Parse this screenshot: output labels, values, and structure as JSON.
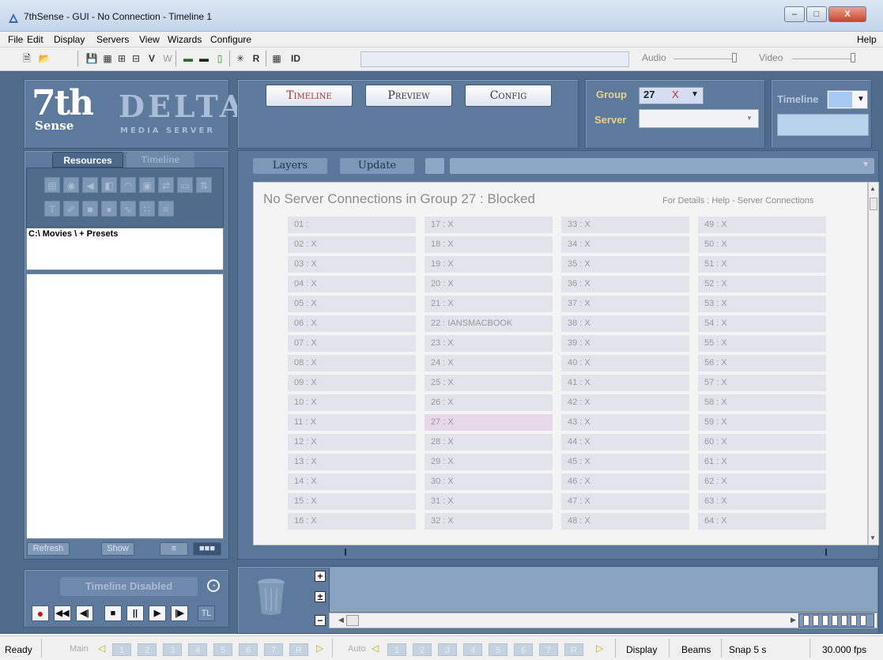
{
  "window": {
    "title": "7thSense -  GUI  - No Connection - Timeline 1",
    "minimize_icon": "minimize-icon",
    "maximize_icon": "maximize-icon",
    "close_label": "X"
  },
  "menu": {
    "file": "File",
    "edit": "Edit",
    "display": "Display",
    "servers": "Servers",
    "view": "View",
    "wizards": "Wizards",
    "configure": "Configure",
    "help": "Help"
  },
  "toolbar": {
    "v_label": "V",
    "w_label": "W",
    "r_label": "R",
    "id_label": "ID",
    "audio_label": "Audio",
    "video_label": "Video"
  },
  "logo": {
    "brand_top": "7th",
    "brand_bottom": "Sense",
    "product": "DELTA",
    "product_sub": "MEDIA SERVER"
  },
  "modes": {
    "timeline": "Timeline",
    "preview": "Preview",
    "config": "Config",
    "active": "timeline"
  },
  "group": {
    "label": "Group",
    "value": "27",
    "clear": "X",
    "server_label": "Server",
    "server_value": "",
    "timeline_label": "Timeline"
  },
  "left": {
    "tabs": [
      "Resources",
      "Timeline"
    ],
    "active_tab": "Resources",
    "path": "C:\\ Movies \\  + Presets",
    "refresh": "Refresh",
    "show": "Show"
  },
  "center": {
    "layers": "Layers",
    "update": "Update",
    "message": "No Server Connections in Group 27 : Blocked",
    "details": "For Details : Help - Server Connections",
    "columns": [
      [
        "01 :",
        "02 : X",
        "03 : X",
        "04 : X",
        "05 : X",
        "06 : X",
        "07 : X",
        "08 : X",
        "09 : X",
        "10 : X",
        "11 : X",
        "12 : X",
        "13 : X",
        "14 : X",
        "15 : X",
        "16 : X"
      ],
      [
        "17 : X",
        "18 : X",
        "19 : X",
        "20 : X",
        "21 : X",
        "22 : IANSMACBOOK",
        "23 : X",
        "24 : X",
        "25 : X",
        "26 : X",
        "27 : X",
        "28 : X",
        "29 : X",
        "30 : X",
        "31 : X",
        "32 : X"
      ],
      [
        "33 : X",
        "34 : X",
        "35 : X",
        "36 : X",
        "37 : X",
        "38 : X",
        "39 : X",
        "40 : X",
        "41 : X",
        "42 : X",
        "43 : X",
        "44 : X",
        "45 : X",
        "46 : X",
        "47 : X",
        "48 : X"
      ],
      [
        "49 : X",
        "50 : X",
        "51 : X",
        "52 : X",
        "53 : X",
        "54 : X",
        "55 : X",
        "56 : X",
        "57 : X",
        "58 : X",
        "59 : X",
        "60 : X",
        "61 : X",
        "62 : X",
        "63 : X",
        "64 : X"
      ]
    ],
    "selected_cell": "27 : X"
  },
  "transport": {
    "status": "Timeline Disabled",
    "tl_label": "TL"
  },
  "status": {
    "ready": "Ready",
    "main": "Main",
    "auto": "Auto",
    "slots": [
      "1",
      "2",
      "3",
      "4",
      "5",
      "6",
      "7",
      "R"
    ],
    "display": "Display",
    "beams": "Beams",
    "snap": "Snap 5 s",
    "fps": "30.000 fps"
  },
  "colors": {
    "panel_bg": "#4f6b8c",
    "accent_gold": "#e6d28a",
    "selected_cell": "#e6d8e6",
    "timeline_active": "#b03030"
  }
}
